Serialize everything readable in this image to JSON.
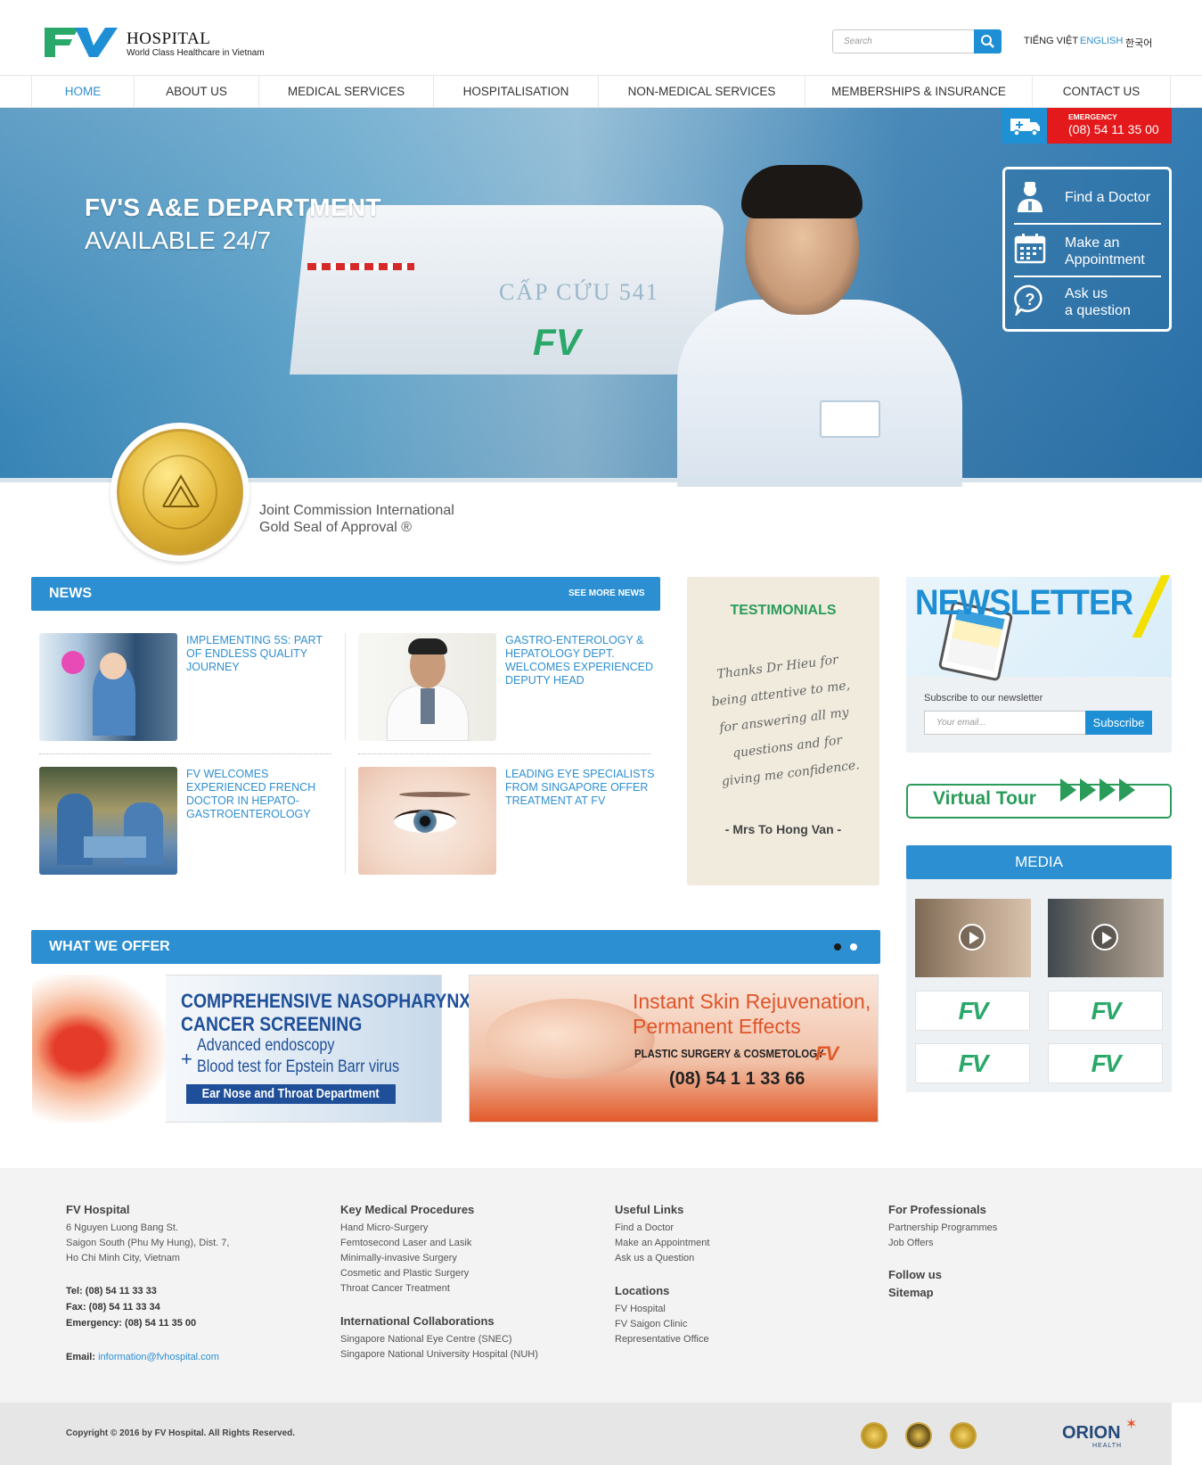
{
  "header": {
    "logo_mark": "FV",
    "logo_title": "HOSPITAL",
    "logo_subtitle": "World Class Healthcare in Vietnam",
    "search_placeholder": "Search",
    "languages": [
      "TIẾNG VIỆT",
      "ENGLISH",
      "한국어"
    ],
    "active_language": "ENGLISH"
  },
  "nav": {
    "items": [
      "HOME",
      "ABOUT US",
      "MEDICAL SERVICES",
      "HOSPITALISATION",
      "NON-MEDICAL SERVICES",
      "MEMBERSHIPS & INSURANCE",
      "CONTACT US"
    ],
    "active": "HOME"
  },
  "hero": {
    "title": "FV'S A&E DEPARTMENT",
    "subtitle": "AVAILABLE 24/7",
    "ambulance_text": "CẤP CỨU 541",
    "ambulance_logo": "FV"
  },
  "emergency": {
    "label": "EMERGENCY",
    "phone": "(08) 54 11 35 00"
  },
  "quick_links": [
    {
      "icon": "doctor-icon",
      "line1": "Find a Doctor",
      "line2": ""
    },
    {
      "icon": "calendar-icon",
      "line1": "Make an",
      "line2": "Appointment"
    },
    {
      "icon": "question-icon",
      "line1": "Ask us",
      "line2": "a question"
    }
  ],
  "accreditation": {
    "line1": "Joint Commission International",
    "line2": "Gold Seal of Approval ®"
  },
  "news": {
    "title": "NEWS",
    "see_more": "SEE MORE NEWS",
    "items": [
      {
        "title": "IMPLEMENTING 5S: PART OF ENDLESS QUALITY JOURNEY"
      },
      {
        "title": "GASTRO-ENTEROLOGY & HEPATOLOGY DEPT. WELCOMES EXPERIENCED DEPUTY HEAD"
      },
      {
        "title": "FV WELCOMES EXPERIENCED FRENCH DOCTOR IN HEPATO-GASTROENTEROLOGY"
      },
      {
        "title": "LEADING EYE SPECIALISTS FROM SINGAPORE OFFER TREATMENT AT FV"
      }
    ]
  },
  "testimonials": {
    "title": "TESTIMONIALS",
    "quote": "Thanks Dr Hieu for being attentive to me, for answering all my questions and for giving me confidence.",
    "author": "- Mrs To Hong Van -"
  },
  "newsletter": {
    "title": "NEWSLETTER",
    "label": "Subscribe to our newsletter",
    "email_placeholder": "Your email...",
    "button": "Subscribe"
  },
  "virtual_tour": {
    "label": "Virtual Tour"
  },
  "media": {
    "title": "MEDIA",
    "logo_text": "FV"
  },
  "offer": {
    "title": "WHAT WE OFFER",
    "slide_count": 2,
    "active_slide": 2,
    "banner1": {
      "line1": "COMPREHENSIVE NASOPHARYNX",
      "line2": "CANCER SCREENING",
      "line3": "Advanced endoscopy",
      "plus": "+",
      "line4": "Blood test for Epstein Barr virus",
      "dept": "Ear Nose and Throat Department"
    },
    "banner2": {
      "line1": "Instant Skin Rejuvenation,",
      "line2": "Permanent Effects",
      "line3": "PLASTIC SURGERY & COSMETOLOGY",
      "phone": "(08) 54 1 1 33 66",
      "logo": "FV"
    }
  },
  "footer": {
    "col1": {
      "title": "FV Hospital",
      "address": [
        "6 Nguyen Luong Bang St.",
        "Saigon South (Phu My Hung), Dist. 7,",
        "Ho Chi Minh City, Vietnam"
      ],
      "tel": "Tel: (08) 54 11 33 33",
      "fax": "Fax: (08) 54 11 33 34",
      "emergency": "Emergency: (08) 54 11 35 00",
      "email_label": "Email:",
      "email": "information@fvhospital.com"
    },
    "col2": {
      "title1": "Key Medical Procedures",
      "items1": [
        "Hand Micro-Surgery",
        "Femtosecond Laser and Lasik",
        "Minimally-invasive Surgery",
        "Cosmetic and Plastic Surgery",
        "Throat Cancer Treatment"
      ],
      "title2": "International Collaborations",
      "items2": [
        "Singapore National Eye Centre (SNEC)",
        "Singapore National University Hospital (NUH)"
      ]
    },
    "col3": {
      "title1": "Useful Links",
      "items1": [
        "Find a Doctor",
        "Make an Appointment",
        "Ask us a Question"
      ],
      "title2": "Locations",
      "items2": [
        "FV Hospital",
        "FV Saigon Clinic",
        "Representative Office"
      ]
    },
    "col4": {
      "title1": "For Professionals",
      "items1": [
        "Partnership Programmes",
        "Job Offers"
      ],
      "follow": "Follow us",
      "sitemap": "Sitemap"
    }
  },
  "bottom": {
    "copyright": "Copyright © 2016 by FV Hospital. All Rights Reserved.",
    "partner": "ORION",
    "partner_sub": "HEALTH"
  },
  "colors": {
    "brand_blue": "#2c8fd2",
    "brand_green": "#2aa86a",
    "emergency_red": "#e3191b",
    "link_blue": "#2f8fd0"
  }
}
